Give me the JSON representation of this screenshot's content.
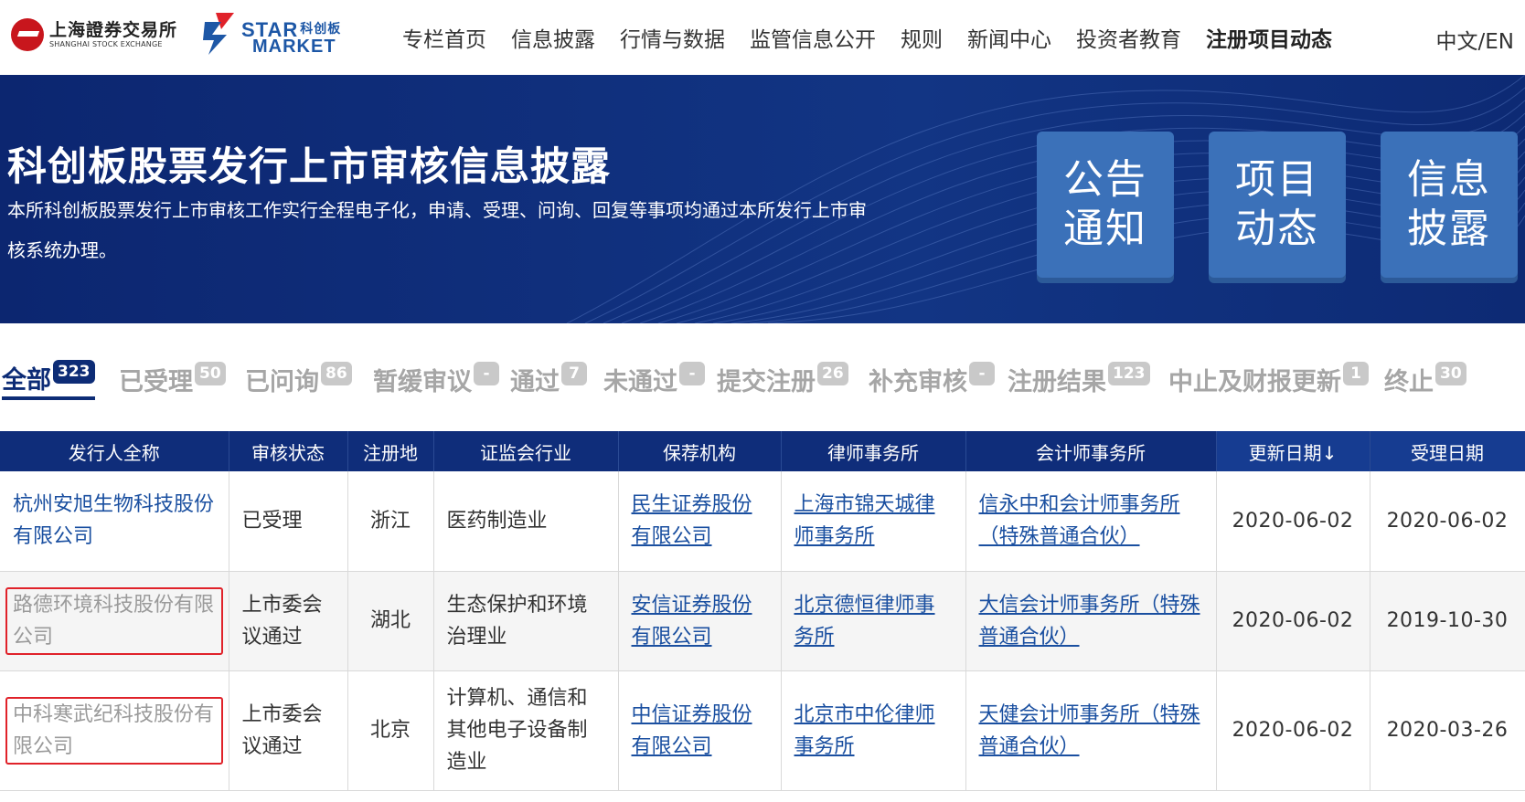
{
  "header": {
    "sse_logo": {
      "cn": "上海證券交易所",
      "en": "SHANGHAI STOCK EXCHANGE"
    },
    "star_logo": {
      "line1": "STAR",
      "line1_cn": "科创板",
      "line2": "MARKET"
    },
    "nav": [
      "专栏首页",
      "信息披露",
      "行情与数据",
      "监管信息公开",
      "规则",
      "新闻中心",
      "投资者教育",
      "注册项目动态"
    ],
    "active_nav": "注册项目动态",
    "lang": "中文/EN"
  },
  "banner": {
    "title": "科创板股票发行上市审核信息披露",
    "desc": "本所科创板股票发行上市审核工作实行全程电子化，申请、受理、问询、回复等事项均通过本所发行上市审核系统办理。",
    "quick_links": [
      {
        "line1": "公告",
        "line2": "通知"
      },
      {
        "line1": "项目",
        "line2": "动态"
      },
      {
        "line1": "信息",
        "line2": "披露"
      }
    ]
  },
  "tabs": [
    {
      "label": "全部",
      "count": "323",
      "active": true
    },
    {
      "label": "已受理",
      "count": "50"
    },
    {
      "label": "已问询",
      "count": "86"
    },
    {
      "label": "暂缓审议",
      "count": "-"
    },
    {
      "label": "通过",
      "count": "7"
    },
    {
      "label": "未通过",
      "count": "-"
    },
    {
      "label": "提交注册",
      "count": "26"
    },
    {
      "label": "补充审核",
      "count": "-"
    },
    {
      "label": "注册结果",
      "count": "123"
    },
    {
      "label": "中止及财报更新",
      "count": "1"
    },
    {
      "label": "终止",
      "count": "30"
    }
  ],
  "table": {
    "columns": [
      "发行人全称",
      "审核状态",
      "注册地",
      "证监会行业",
      "保荐机构",
      "律师事务所",
      "会计师事务所",
      "更新日期↓",
      "受理日期"
    ],
    "rows": [
      {
        "issuer": "杭州安旭生物科技股份有限公司",
        "status": "已受理",
        "region": "浙江",
        "industry": "医药制造业",
        "sponsor": "民生证券股份有限公司",
        "law_firm": "上海市锦天城律师事务所",
        "accounting": "信永中和会计师事务所（特殊普通合伙）",
        "updated": "2020-06-02",
        "accepted": "2020-06-02",
        "highlighted": false
      },
      {
        "issuer": "路德环境科技股份有限公司",
        "status": "上市委会议通过",
        "region": "湖北",
        "industry": "生态保护和环境治理业",
        "sponsor": "安信证券股份有限公司",
        "law_firm": "北京德恒律师事务所",
        "accounting": "大信会计师事务所（特殊普通合伙）",
        "updated": "2020-06-02",
        "accepted": "2019-10-30",
        "highlighted": true
      },
      {
        "issuer": "中科寒武纪科技股份有限公司",
        "status": "上市委会议通过",
        "region": "北京",
        "industry": "计算机、通信和其他电子设备制造业",
        "sponsor": "中信证券股份有限公司",
        "law_firm": "北京市中伦律师事务所",
        "accounting": "天健会计师事务所（特殊普通合伙）",
        "updated": "2020-06-02",
        "accepted": "2020-03-26",
        "highlighted": true
      }
    ]
  },
  "colors": {
    "primary_navy": "#0f2d7a",
    "quick_button": "#3b71b9",
    "link": "#1a4fa0",
    "highlight_border": "#e0222a",
    "sse_red": "#c8161d"
  }
}
